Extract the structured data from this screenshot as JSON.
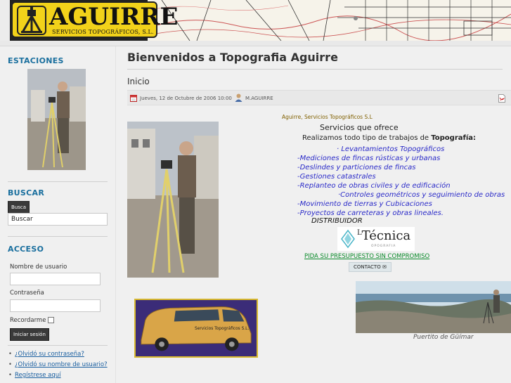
{
  "header": {
    "logo_title": "AGUIRRE",
    "logo_subtitle": "SERVICIOS TOPOGRÁFICOS, S.L."
  },
  "sidebar": {
    "estaciones_title": "ESTACIONES",
    "buscar_title": "BUSCAR",
    "search_button": "Busca",
    "search_value": "Buscar",
    "acceso_title": "ACCESO",
    "username_label": "Nombre de usuario",
    "password_label": "Contraseña",
    "remember_label": "Recordarme",
    "login_button": "Iniciar sesión",
    "links": [
      "¿Olvidó su contraseña?",
      "¿Olvidó su nombre de usuario?",
      "Regístrese aquí"
    ]
  },
  "main": {
    "page_title": "Bienvenidos a Topografia Aguirre",
    "article_title": "Inicio",
    "meta_date": "Jueves, 12 de Octubre de 2006 10:00",
    "meta_author": "M.AGUIRRE",
    "intro": "Aguirre, Servicios Topográficos S.L",
    "services_title": "Servicios que ofrece",
    "services_sub_prefix": "Realizamos todo tipo de trabajos de ",
    "services_sub_bold": "Topografía:",
    "services": [
      "· Levantamientos Topográficos",
      "-Mediciones de fincas rústicas y urbanas",
      "-Deslindes y particiones de fincas",
      "-Gestiones catastrales",
      "-Replanteo de obras civiles y de edificación",
      "·Controles geométricos y seguimiento de obras",
      "-Movimiento de tierras y Cubicaciones",
      "-Proyectos de carreteras y obras lineales."
    ],
    "distributor_label": "DISTRIBUIDOR",
    "distributor_logo": "Técnica",
    "distributor_logo_sup": "L",
    "distributor_logo_sub": "OPOGRAFIA",
    "promo": "PIDA SU PRESUPUESTO SIN COMPROMISO",
    "contact_button": "CONTACTO",
    "van_text": "Servicios Topográficos S.L.",
    "caption": "Puertito de Güímar"
  }
}
